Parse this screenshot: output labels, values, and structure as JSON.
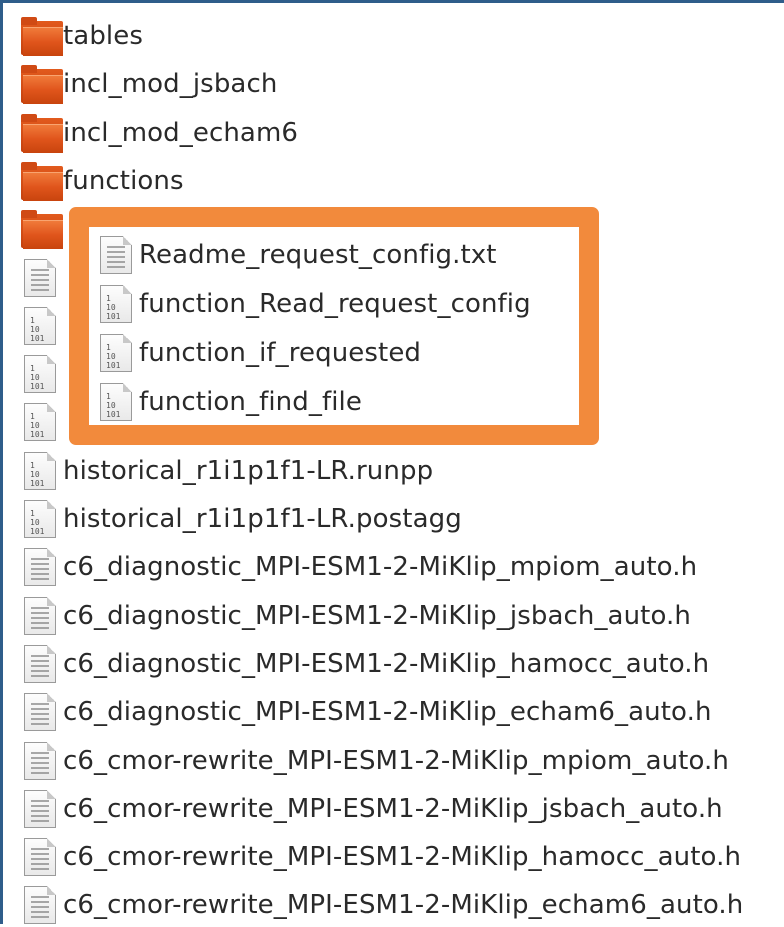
{
  "files": [
    {
      "name": "tables",
      "icon": "folder-icon"
    },
    {
      "name": "incl_mod_jsbach",
      "icon": "folder-icon"
    },
    {
      "name": "incl_mod_echam6",
      "icon": "folder-icon"
    },
    {
      "name": "functions",
      "icon": "folder-icon"
    },
    {
      "name": "",
      "icon": "folder-icon"
    },
    {
      "name": "",
      "icon": "text-file-icon"
    },
    {
      "name": "",
      "icon": "binary-file-icon"
    },
    {
      "name": "",
      "icon": "binary-file-icon"
    },
    {
      "name": "",
      "icon": "binary-file-icon"
    },
    {
      "name": "historical_r1i1p1f1-LR.runpp",
      "icon": "binary-file-icon"
    },
    {
      "name": "historical_r1i1p1f1-LR.postagg",
      "icon": "binary-file-icon"
    },
    {
      "name": "c6_diagnostic_MPI-ESM1-2-MiKlip_mpiom_auto.h",
      "icon": "text-file-icon"
    },
    {
      "name": "c6_diagnostic_MPI-ESM1-2-MiKlip_jsbach_auto.h",
      "icon": "text-file-icon"
    },
    {
      "name": "c6_diagnostic_MPI-ESM1-2-MiKlip_hamocc_auto.h",
      "icon": "text-file-icon"
    },
    {
      "name": "c6_diagnostic_MPI-ESM1-2-MiKlip_echam6_auto.h",
      "icon": "text-file-icon"
    },
    {
      "name": "c6_cmor-rewrite_MPI-ESM1-2-MiKlip_mpiom_auto.h",
      "icon": "text-file-icon"
    },
    {
      "name": "c6_cmor-rewrite_MPI-ESM1-2-MiKlip_jsbach_auto.h",
      "icon": "text-file-icon"
    },
    {
      "name": "c6_cmor-rewrite_MPI-ESM1-2-MiKlip_hamocc_auto.h",
      "icon": "text-file-icon"
    },
    {
      "name": "c6_cmor-rewrite_MPI-ESM1-2-MiKlip_echam6_auto.h",
      "icon": "text-file-icon"
    }
  ],
  "highlighted": [
    {
      "name": "Readme_request_config.txt",
      "icon": "text-file-icon"
    },
    {
      "name": "function_Read_request_config",
      "icon": "binary-file-icon"
    },
    {
      "name": "function_if_requested",
      "icon": "binary-file-icon"
    },
    {
      "name": "function_find_file",
      "icon": "binary-file-icon"
    }
  ],
  "colors": {
    "folder": "#e0551c",
    "highlight_border": "#f28a3c",
    "frame_border": "#2f5d8a",
    "text": "#2a2a2a"
  }
}
